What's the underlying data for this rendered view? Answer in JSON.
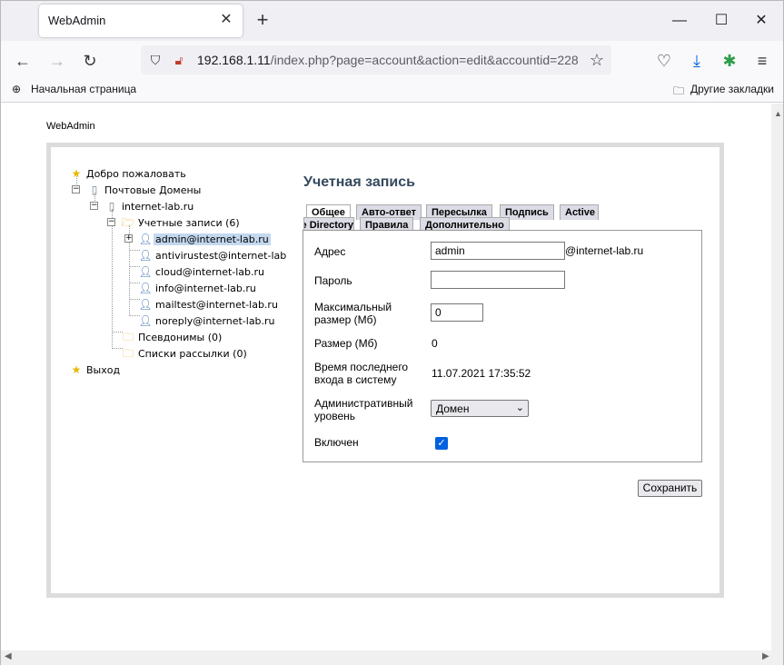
{
  "browser": {
    "tab_title": "WebAdmin",
    "url_host": "192.168.1.11",
    "url_path": "/index.php?page=account&action=edit&accountid=228",
    "bookmarks": {
      "home": "Начальная страница",
      "other": "Другие закладки"
    }
  },
  "page": {
    "brand": "WebAdmin",
    "tree": {
      "welcome": "Добро пожаловать",
      "mail_domains": "Почтовые Домены",
      "domain": "internet-lab.ru",
      "accounts": "Учетные записи (6)",
      "account_items": [
        "admin@internet-lab.ru",
        "antivirustest@internet-lab",
        "cloud@internet-lab.ru",
        "info@internet-lab.ru",
        "mailtest@internet-lab.ru",
        "noreply@internet-lab.ru"
      ],
      "aliases": "Псевдонимы (0)",
      "lists": "Списки рассылки (0)",
      "logout": "Выход"
    },
    "editor": {
      "title": "Учетная запись",
      "tabs": [
        "Общее",
        "Авто-ответ",
        "Пересылка",
        "Подпись",
        "Active Directory",
        "Правила",
        "Дополнительно"
      ],
      "fields": {
        "address_label": "Адрес",
        "address_value": "admin",
        "address_suffix": "@internet-lab.ru",
        "password_label": "Пароль",
        "password_value": "",
        "maxsize_label": "Максимальный размер (Мб)",
        "maxsize_value": "0",
        "size_label": "Размер (Мб)",
        "size_value": "0",
        "lastlogin_label": "Время последнего входа в систему",
        "lastlogin_value": "11.07.2021 17:35:52",
        "adminlevel_label": "Административный уровень",
        "adminlevel_value": "Домен",
        "enabled_label": "Включен",
        "enabled": true
      },
      "save_label": "Сохранить"
    }
  }
}
